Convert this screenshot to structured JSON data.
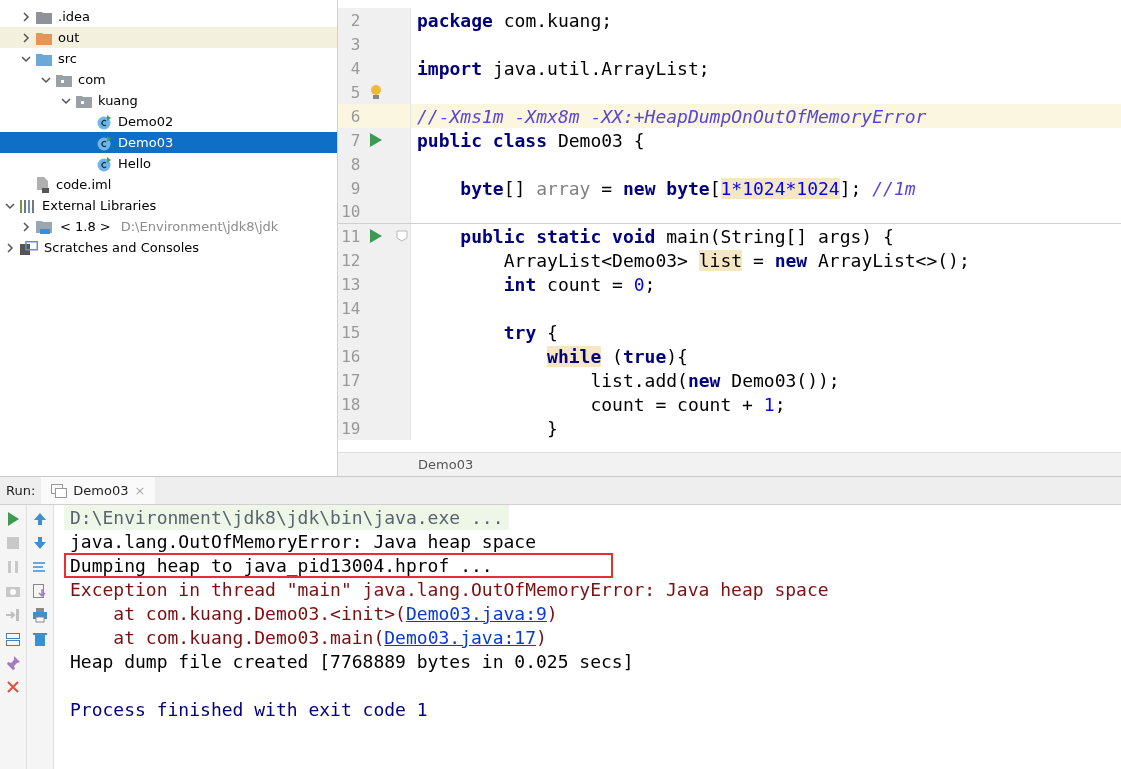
{
  "project_tree": [
    {
      "label": ".idea",
      "kind": "folder-grey",
      "expanded": false,
      "selected": false,
      "highlighted": false
    },
    {
      "label": "out",
      "kind": "folder-orange",
      "expanded": false,
      "selected": false,
      "highlighted": true
    },
    {
      "label": "src",
      "kind": "folder-blue",
      "expanded": true,
      "selected": false,
      "highlighted": false,
      "children": [
        {
          "label": "com",
          "kind": "package",
          "expanded": true,
          "selected": false,
          "highlighted": false,
          "children": [
            {
              "label": "kuang",
              "kind": "package",
              "expanded": true,
              "selected": false,
              "highlighted": false,
              "children": [
                {
                  "label": "Demo02",
                  "kind": "class",
                  "selected": false,
                  "highlighted": false
                },
                {
                  "label": "Demo03",
                  "kind": "class",
                  "selected": true,
                  "highlighted": false
                },
                {
                  "label": "Hello",
                  "kind": "class",
                  "selected": false,
                  "highlighted": false
                }
              ]
            }
          ]
        }
      ]
    },
    {
      "label": "code.iml",
      "kind": "file",
      "selected": false,
      "highlighted": false
    },
    {
      "label": "External Libraries",
      "kind": "library",
      "expanded": true,
      "selected": false,
      "highlighted": false,
      "root": true,
      "children": [
        {
          "label": "< 1.8 >",
          "hint": "D:\\Environment\\jdk8\\jdk",
          "kind": "jdk",
          "expanded": false,
          "selected": false,
          "highlighted": false
        }
      ]
    },
    {
      "label": "Scratches and Consoles",
      "kind": "scratches",
      "expanded": false,
      "selected": false,
      "highlighted": false,
      "root": true
    }
  ],
  "editor": {
    "lines": [
      {
        "number": "2",
        "tokens": [
          {
            "t": "package",
            "kind": "keyword"
          },
          {
            "t": " com.kuang;",
            "kind": "plain"
          }
        ]
      },
      {
        "number": "3"
      },
      {
        "number": "4",
        "tokens": [
          {
            "t": "import",
            "kind": "keyword"
          },
          {
            "t": " java.util.ArrayList;",
            "kind": "plain"
          }
        ]
      },
      {
        "number": "5",
        "bulb": true
      },
      {
        "number": "6",
        "current": true,
        "tokens": [
          {
            "t": "//-Xms1m -Xmx8m -XX:+HeapDumpOnOutOfMemoryError",
            "kind": "comment"
          }
        ]
      },
      {
        "number": "7",
        "run_marker": true,
        "tokens": [
          {
            "t": "public class",
            "kind": "keyword"
          },
          {
            "t": " Demo03 {",
            "kind": "plain"
          }
        ]
      },
      {
        "number": "8"
      },
      {
        "number": "9",
        "tokens": [
          {
            "t": "    byte",
            "kind": "keyword"
          },
          {
            "t": "[] ",
            "kind": "plain"
          },
          {
            "t": "array",
            "kind": "field"
          },
          {
            "t": " = ",
            "kind": "plain"
          },
          {
            "t": "new byte",
            "kind": "keyword"
          },
          {
            "t": "[",
            "kind": "plain"
          },
          {
            "t": "1*1024*1024",
            "kind": "number",
            "hl": true
          },
          {
            "t": "]; ",
            "kind": "plain"
          },
          {
            "t": "//1m",
            "kind": "comment"
          }
        ]
      },
      {
        "number": "10",
        "separator": true
      },
      {
        "number": "11",
        "run_marker": true,
        "fold": true,
        "tokens": [
          {
            "t": "    public static void",
            "kind": "keyword"
          },
          {
            "t": " main(String[] args) {",
            "kind": "plain"
          }
        ]
      },
      {
        "number": "12",
        "tokens": [
          {
            "t": "        ArrayList<Demo03> ",
            "kind": "plain"
          },
          {
            "t": "list",
            "kind": "plain",
            "hl": true
          },
          {
            "t": " = ",
            "kind": "plain"
          },
          {
            "t": "new",
            "kind": "keyword"
          },
          {
            "t": " ArrayList<>();",
            "kind": "plain"
          }
        ]
      },
      {
        "number": "13",
        "tokens": [
          {
            "t": "        int",
            "kind": "keyword"
          },
          {
            "t": " count = ",
            "kind": "plain"
          },
          {
            "t": "0",
            "kind": "number"
          },
          {
            "t": ";",
            "kind": "plain"
          }
        ]
      },
      {
        "number": "14"
      },
      {
        "number": "15",
        "tokens": [
          {
            "t": "        try",
            "kind": "keyword"
          },
          {
            "t": " {",
            "kind": "plain"
          }
        ]
      },
      {
        "number": "16",
        "tokens": [
          {
            "t": "            while",
            "kind": "keyword",
            "hl": true
          },
          {
            "t": " (",
            "kind": "plain"
          },
          {
            "t": "true",
            "kind": "keyword"
          },
          {
            "t": "){",
            "kind": "plain"
          }
        ]
      },
      {
        "number": "17",
        "tokens": [
          {
            "t": "                list.add(",
            "kind": "plain"
          },
          {
            "t": "new",
            "kind": "keyword"
          },
          {
            "t": " Demo03());",
            "kind": "plain"
          }
        ]
      },
      {
        "number": "18",
        "tokens": [
          {
            "t": "                count = count + ",
            "kind": "plain"
          },
          {
            "t": "1",
            "kind": "number"
          },
          {
            "t": ";",
            "kind": "plain"
          }
        ]
      },
      {
        "number": "19",
        "tokens": [
          {
            "t": "            }",
            "kind": "plain"
          }
        ]
      }
    ],
    "breadcrumb": "Demo03"
  },
  "run_panel": {
    "label": "Run:",
    "tab": {
      "label": "Demo03",
      "close": "×",
      "selected": true
    },
    "lines": [
      {
        "kind": "command",
        "text": "D:\\Environment\\jdk8\\jdk\\bin\\java.exe ...",
        "boxed": false
      },
      {
        "kind": "stdout",
        "text": "java.lang.OutOfMemoryError: Java heap space",
        "boxed": false
      },
      {
        "kind": "stdout",
        "text": "Dumping heap to java_pid13004.hprof ...",
        "boxed": true
      },
      {
        "kind": "stderr",
        "text": "Exception in thread \"main\" java.lang.OutOfMemoryError: Java heap space",
        "boxed": false
      },
      {
        "kind": "stderr",
        "text": "    at com.kuang.Demo03.<init>(",
        "link": "Demo03.java:9",
        "after": ")",
        "boxed": false
      },
      {
        "kind": "stderr",
        "text": "    at com.kuang.Demo03.main(",
        "link": "Demo03.java:17",
        "after": ")",
        "boxed": false
      },
      {
        "kind": "stdout",
        "text": "Heap dump file created [7768889 bytes in 0.025 secs]",
        "boxed": false
      },
      {
        "kind": "blank"
      },
      {
        "kind": "system",
        "text": "Process finished with exit code 1",
        "boxed": false
      }
    ]
  }
}
